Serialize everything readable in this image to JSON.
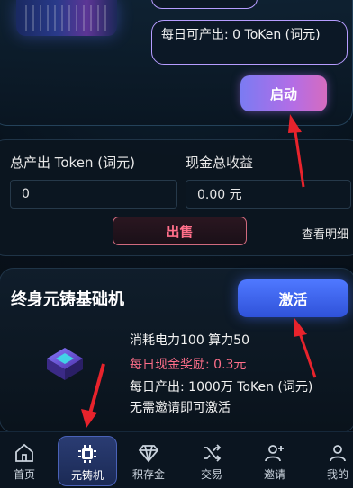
{
  "top_card": {
    "daily_output_label": "每日可产出: 0 ToKen (词元)",
    "start_button": "启动"
  },
  "summary": {
    "total_output_label": "总产出 Token (词元)",
    "total_output_value": "0",
    "cash_income_label": "现金总收益",
    "cash_income_value": "0.00 元",
    "sell_button": "出售",
    "view_detail": "查看明细"
  },
  "machine": {
    "title": "终身元铸基础机",
    "activate_button": "激活",
    "consume_line": "消耗电力100 算力50",
    "cash_reward_line": "每日现金奖励: 0.3元",
    "daily_output_line": "每日产出: 1000万 ToKen (词元)",
    "no_invite_line": "无需邀请即可激活"
  },
  "tabs": [
    {
      "label": "首页",
      "icon": "home-icon"
    },
    {
      "label": "元铸机",
      "icon": "chip-icon"
    },
    {
      "label": "积存金",
      "icon": "diamond-icon"
    },
    {
      "label": "交易",
      "icon": "shuffle-icon"
    },
    {
      "label": "邀请",
      "icon": "add-user-icon"
    },
    {
      "label": "我的",
      "icon": "person-icon"
    }
  ],
  "colors": {
    "accent_purple": "#b69cff",
    "reward_pink": "#ff6f8a",
    "activate_blue": "#3f64ee",
    "annotation_arrow": "#e8232c"
  }
}
